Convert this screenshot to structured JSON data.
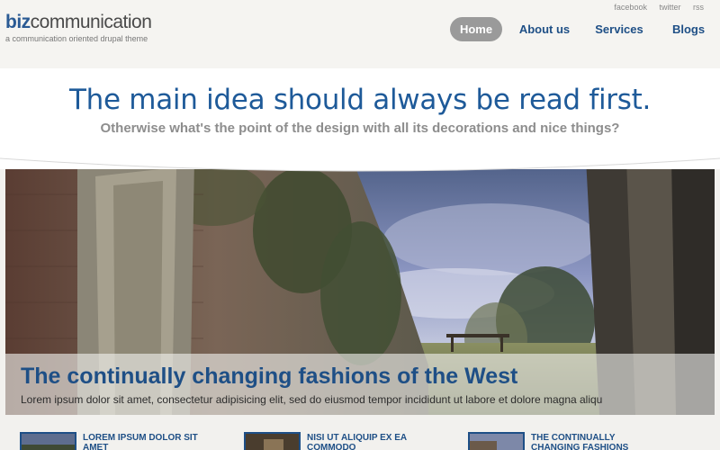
{
  "brand": {
    "logo_bold": "biz",
    "logo_rest": "communication",
    "tagline": "a communication oriented drupal theme"
  },
  "social": {
    "facebook": "facebook",
    "twitter": "twitter",
    "rss": "rss"
  },
  "nav": {
    "home": "Home",
    "about": "About us",
    "services": "Services",
    "blogs": "Blogs",
    "active": "Home"
  },
  "hero": {
    "title": "The main idea should always be read first.",
    "subtitle": "Otherwise what's the point of the design with all its decorations and nice things?"
  },
  "slide": {
    "title": "The continually changing fashions of the West",
    "text": "Lorem ipsum dolor sit amet, consectetur adipisicing elit, sed do eiusmod tempor incididunt ut labore et dolore magna aliqu"
  },
  "teasers": [
    {
      "title": "LOREM IPSUM DOLOR SIT AMET"
    },
    {
      "title": "NISI UT ALIQUIP EX EA COMMODO"
    },
    {
      "title": "THE CONTINUALLY CHANGING FASHIONS"
    }
  ],
  "colors": {
    "brand_blue": "#1e4f86",
    "nav_active": "#9a9a9a",
    "muted_text": "#8d8d8d"
  }
}
